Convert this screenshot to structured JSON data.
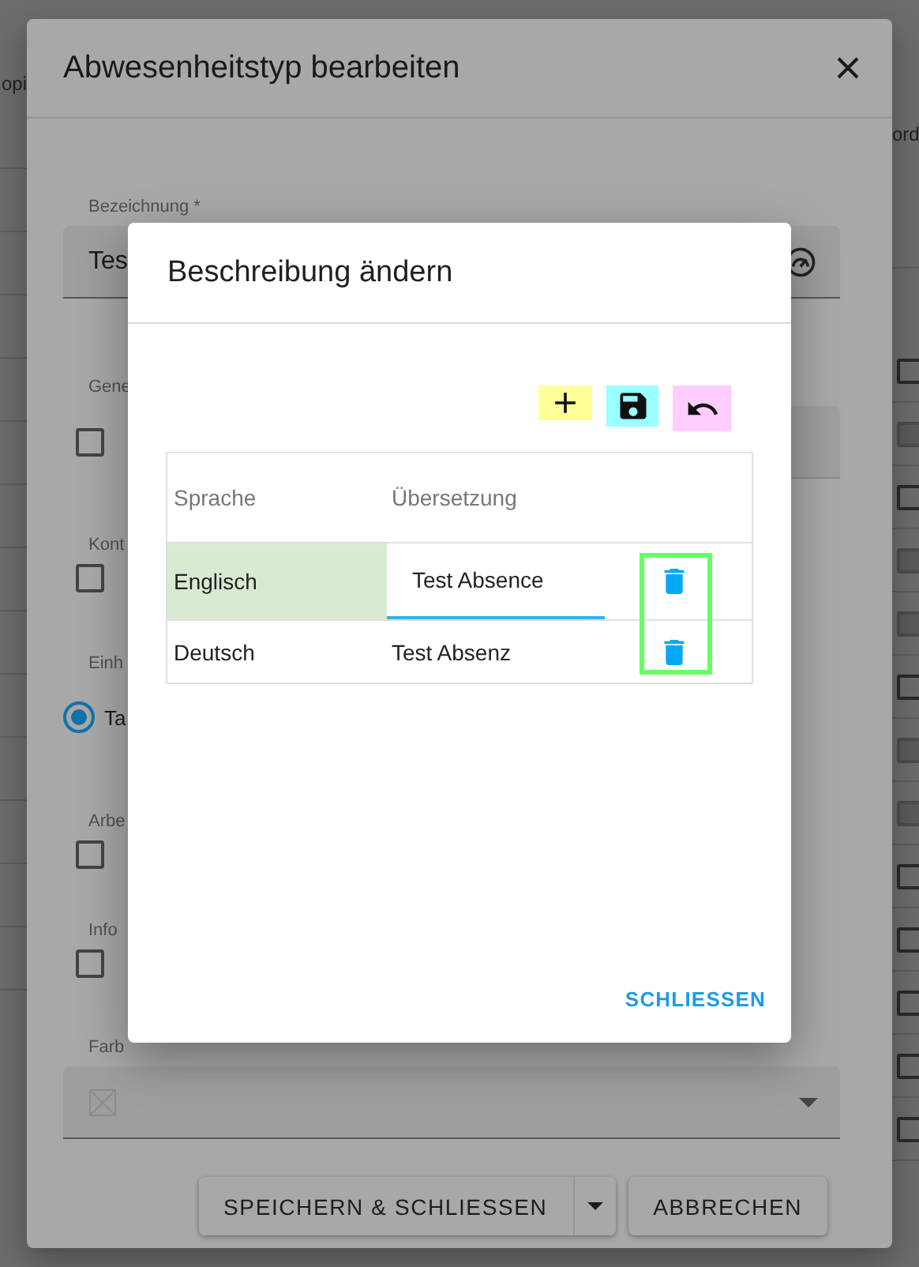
{
  "background": {
    "left_header": "opi",
    "right_header": "ord",
    "rows": [
      {
        "disabled": false
      },
      {
        "disabled": true
      },
      {
        "disabled": false
      },
      {
        "disabled": true
      },
      {
        "disabled": true
      },
      {
        "disabled": false
      },
      {
        "disabled": true
      },
      {
        "disabled": true
      },
      {
        "disabled": false
      },
      {
        "disabled": false
      },
      {
        "disabled": false
      },
      {
        "disabled": false
      },
      {
        "disabled": false
      }
    ]
  },
  "dialog": {
    "title": "Abwesenheitstyp bearbeiten",
    "name_field": {
      "label": "Bezeichnung *",
      "value": "Tes"
    },
    "fields": [
      {
        "kind": "checkbox",
        "label": "Gene",
        "checked": false
      },
      {
        "kind": "checkbox",
        "label": "Kont",
        "checked": false
      },
      {
        "kind": "radio",
        "label": "Einh",
        "option": "Ta",
        "selected": true
      },
      {
        "kind": "checkbox",
        "label": "Arbe",
        "checked": false
      },
      {
        "kind": "checkbox",
        "label": "Info",
        "checked": false
      }
    ],
    "color_field": {
      "label": "Farb"
    },
    "buttons": [
      {
        "kind": "split",
        "label": "SPEICHERN & SCHLIESSEN"
      },
      {
        "kind": "plain",
        "label": "ABBRECHEN"
      }
    ]
  },
  "subdialog": {
    "title": "Beschreibung ändern",
    "toolbar": [
      {
        "kind": "add",
        "color": "#ffff99"
      },
      {
        "kind": "save",
        "color": "#99ffff"
      },
      {
        "kind": "undo",
        "color": "#ffccff"
      }
    ],
    "table": {
      "columns": [
        "Sprache",
        "Übersetzung"
      ],
      "rows": [
        {
          "language": "Englisch",
          "translation": "Test Absence",
          "editing": true
        },
        {
          "language": "Deutsch",
          "translation": "Test Absenz",
          "editing": false
        }
      ]
    },
    "close_button": "SCHLIESSEN"
  }
}
